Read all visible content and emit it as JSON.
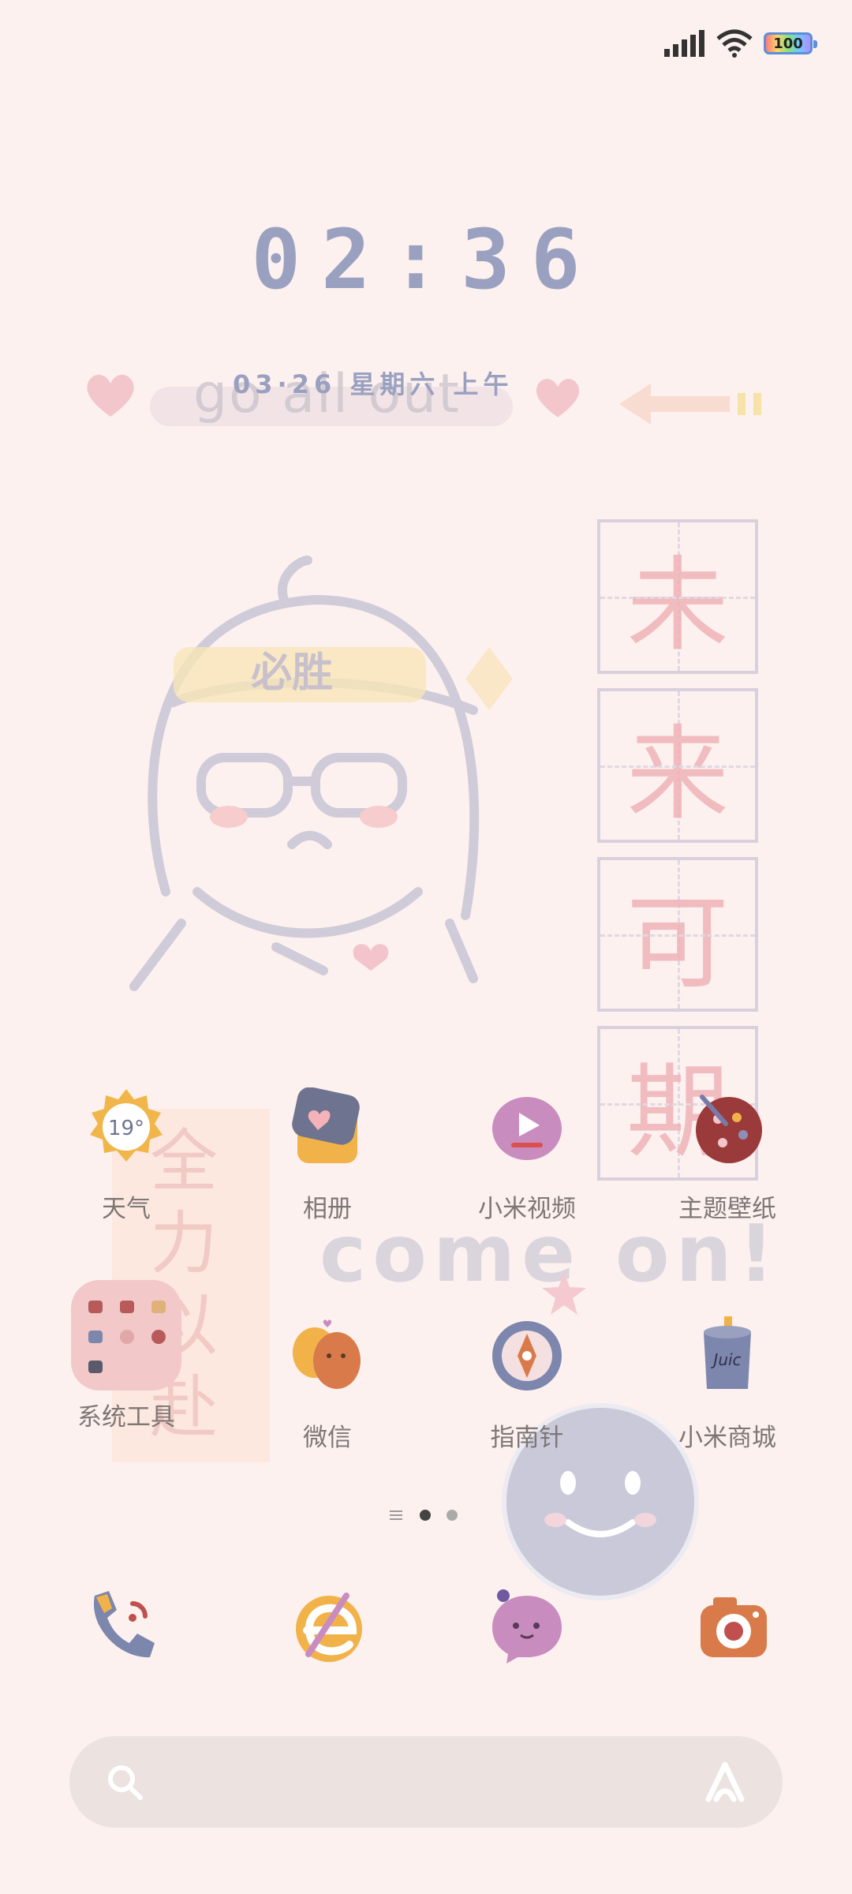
{
  "status_bar": {
    "battery_level": "100"
  },
  "clock": {
    "time": "02:36",
    "date": "03·26 星期六  上午"
  },
  "wallpaper": {
    "headline_scribble": "go all out",
    "headband_text": "必胜",
    "vertical_chars": [
      "未",
      "来",
      "可",
      "期"
    ],
    "side_text": "全力以赴",
    "come_on_text": "come on!"
  },
  "apps": {
    "row1": [
      {
        "label": "天气",
        "icon": "weather-sun-icon",
        "badge": "19°"
      },
      {
        "label": "相册",
        "icon": "gallery-icon"
      },
      {
        "label": "小米视频",
        "icon": "video-play-icon"
      },
      {
        "label": "主题壁纸",
        "icon": "theme-palette-icon"
      }
    ],
    "row2": [
      {
        "label": "系统工具",
        "icon": "folder-icon"
      },
      {
        "label": "微信",
        "icon": "wechat-icon"
      },
      {
        "label": "指南针",
        "icon": "compass-icon"
      },
      {
        "label": "小米商城",
        "icon": "mi-store-icon",
        "badge": "Juic"
      }
    ]
  },
  "dock": [
    {
      "icon": "phone-icon"
    },
    {
      "icon": "browser-icon"
    },
    {
      "icon": "messages-icon"
    },
    {
      "icon": "camera-icon"
    }
  ],
  "page_indicator": {
    "pages": 2,
    "current": 1
  },
  "colors": {
    "background": "#fdf1ef",
    "clock": "#9aa1c0",
    "label": "#7d7775"
  }
}
